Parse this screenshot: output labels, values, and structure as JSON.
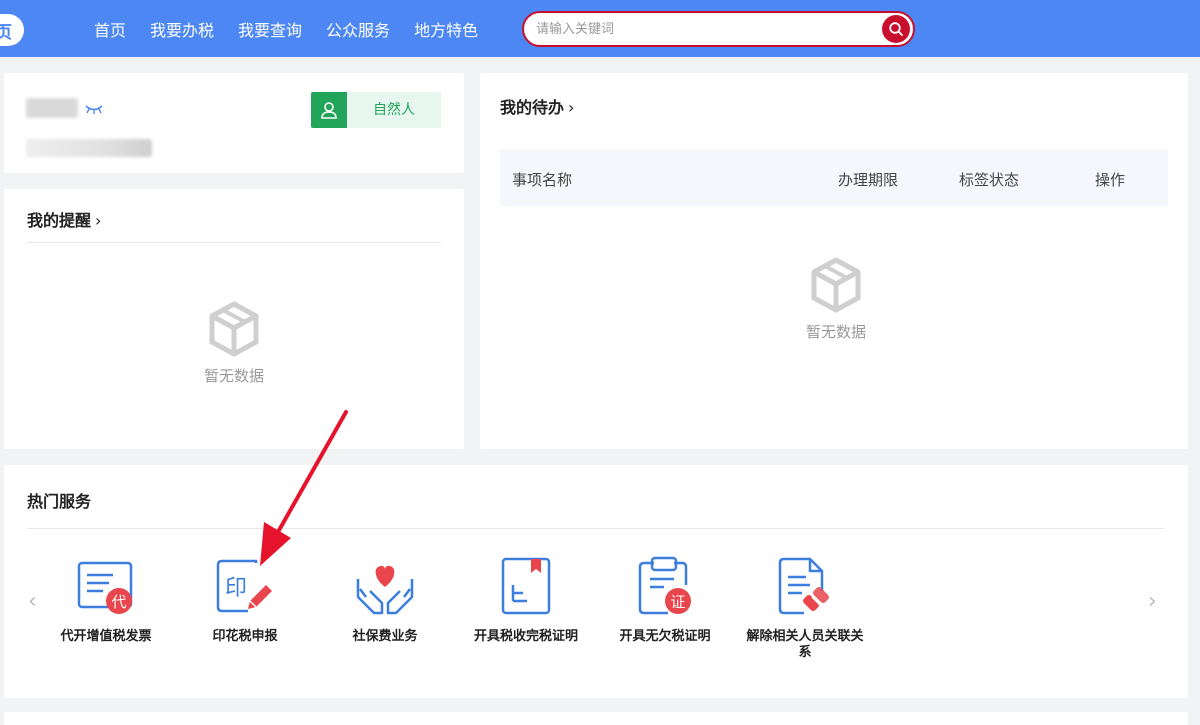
{
  "nav": {
    "logo_char": "页",
    "items": [
      "首页",
      "我要办税",
      "我要查询",
      "公众服务",
      "地方特色"
    ],
    "search_placeholder": "请输入关键词"
  },
  "user": {
    "role_label": "自然人"
  },
  "reminder": {
    "title": "我的提醒",
    "empty_text": "暂无数据"
  },
  "todo": {
    "title": "我的待办",
    "columns": [
      "事项名称",
      "办理期限",
      "标签状态",
      "操作"
    ],
    "empty_text": "暂无数据"
  },
  "hot_services": {
    "title": "热门服务",
    "items": [
      {
        "label": "代开增值税发票",
        "badge": "代"
      },
      {
        "label": "印花税申报",
        "badge": "印"
      },
      {
        "label": "社保费业务"
      },
      {
        "label": "开具税收完税证明"
      },
      {
        "label": "开具无欠税证明",
        "badge": "证"
      },
      {
        "label": "解除相关人员关联关系"
      }
    ]
  },
  "colors": {
    "nav_blue": "#4c87f4",
    "accent_red": "#c8102e",
    "green": "#23a45b",
    "icon_blue": "#3c7ee0"
  }
}
